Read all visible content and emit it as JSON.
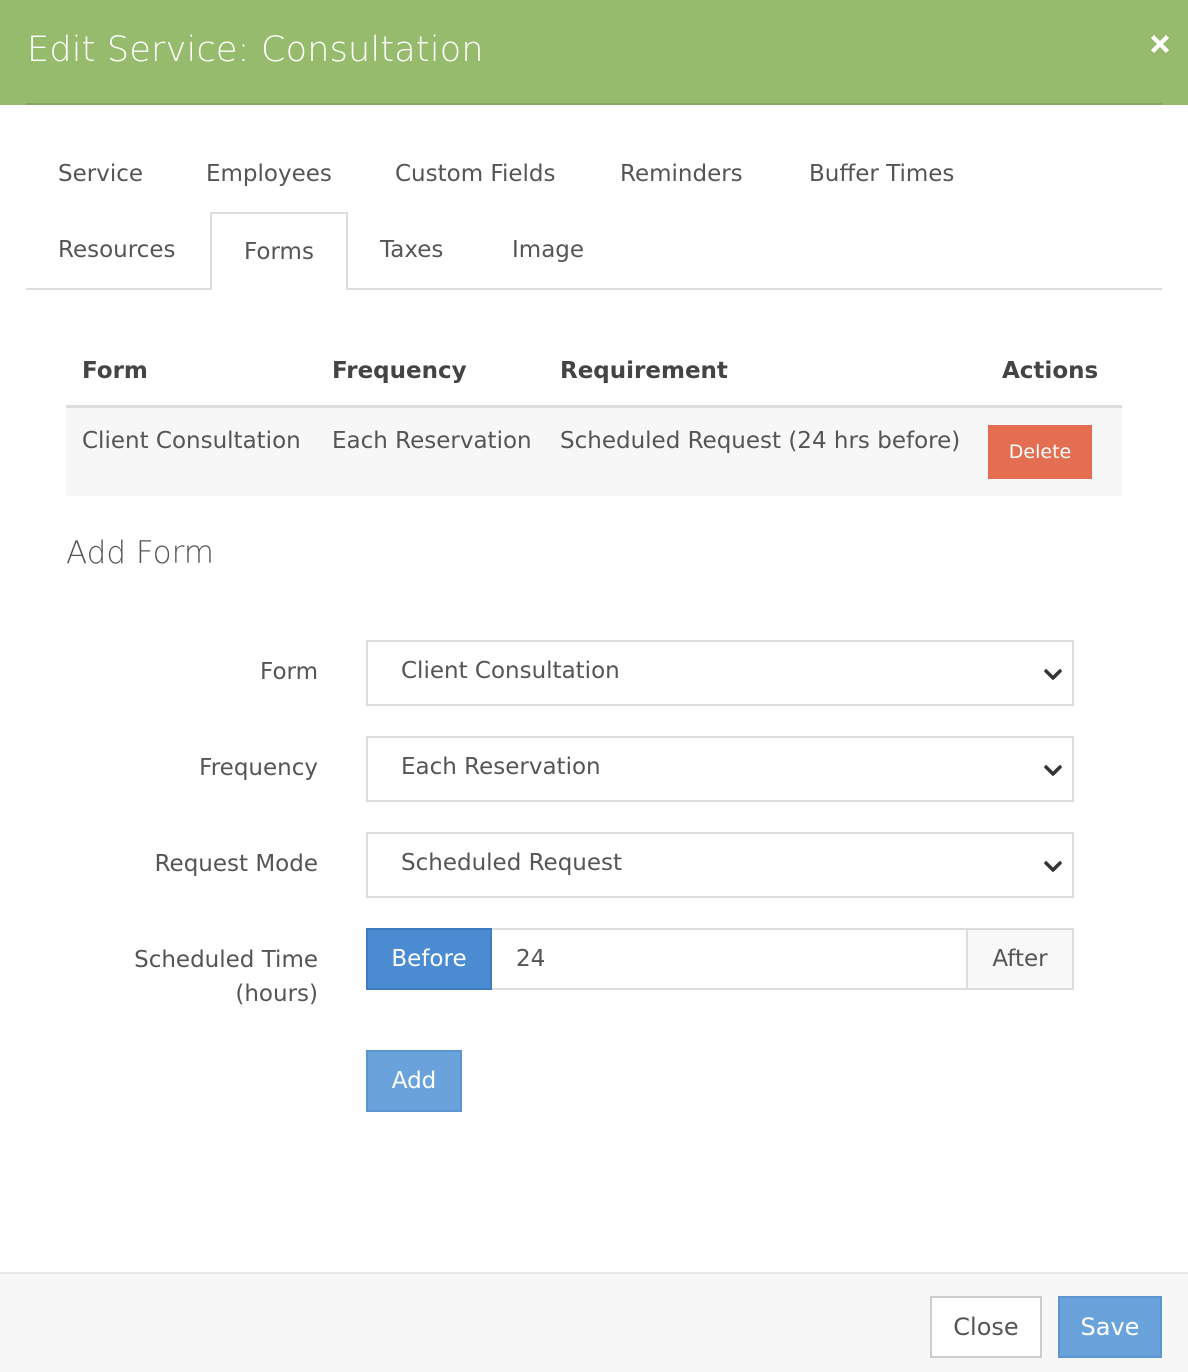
{
  "modal": {
    "title": "Edit Service: Consultation",
    "header_color": "#97bb6d"
  },
  "tabs": [
    {
      "label": "Service"
    },
    {
      "label": "Employees"
    },
    {
      "label": "Custom Fields"
    },
    {
      "label": "Reminders"
    },
    {
      "label": "Buffer Times"
    },
    {
      "label": "Resources"
    },
    {
      "label": "Forms",
      "active": true
    },
    {
      "label": "Taxes"
    },
    {
      "label": "Image"
    }
  ],
  "table": {
    "headers": [
      "Form",
      "Frequency",
      "Requirement",
      "Actions"
    ],
    "rows": [
      {
        "form": "Client Consultation",
        "frequency": "Each Reservation",
        "requirement": "Scheduled Request (24 hrs before)",
        "action_label": "Delete"
      }
    ]
  },
  "add_form": {
    "title": "Add Form",
    "form_label": "Form",
    "form_value": "Client Consultation",
    "frequency_label": "Frequency",
    "frequency_value": "Each Reservation",
    "request_mode_label": "Request Mode",
    "request_mode_value": "Scheduled Request",
    "scheduled_time_label_line1": "Scheduled Time",
    "scheduled_time_label_line2": "(hours)",
    "before_label": "Before",
    "hours_value": "24",
    "after_label": "After",
    "add_label": "Add"
  },
  "footer": {
    "close_label": "Close",
    "save_label": "Save"
  },
  "colors": {
    "primary": "#4a8bd1",
    "danger": "#e46e52"
  },
  "icons": {
    "close": "close-icon",
    "dropdown": "chevron-down-icon"
  }
}
